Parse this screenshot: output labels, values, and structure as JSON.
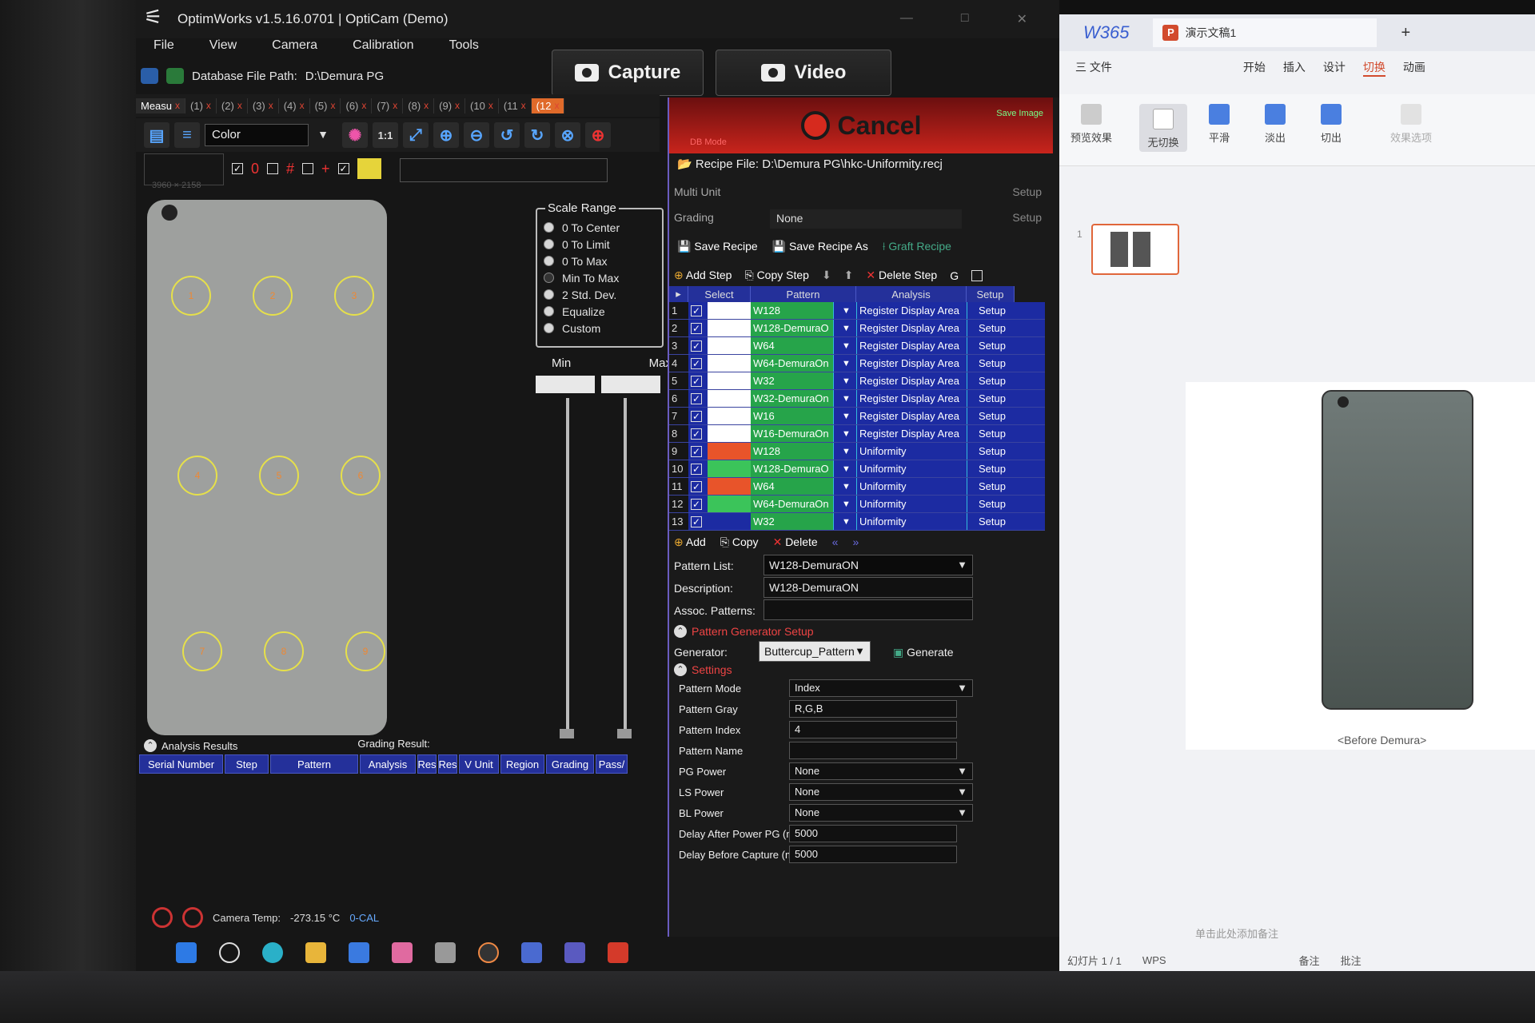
{
  "app": {
    "title": "OptimWorks v1.5.16.0701 | OptiCam (Demo)",
    "menu": [
      "File",
      "View",
      "Camera",
      "Calibration",
      "Tools"
    ],
    "db_label": "Database File Path:",
    "db_path": "D:\\Demura PG",
    "capture": "Capture",
    "video": "Video",
    "tabs": [
      {
        "label": "Measu",
        "close": "x"
      },
      {
        "label": "(1)",
        "close": "x"
      },
      {
        "label": "(2)",
        "close": "x"
      },
      {
        "label": "(3)",
        "close": "x"
      },
      {
        "label": "(4)",
        "close": "x"
      },
      {
        "label": "(5)",
        "close": "x"
      },
      {
        "label": "(6)",
        "close": "x"
      },
      {
        "label": "(7)",
        "close": "x"
      },
      {
        "label": "(8)",
        "close": "x"
      },
      {
        "label": "(9)",
        "close": "x"
      },
      {
        "label": "(10",
        "close": "x"
      },
      {
        "label": "(11",
        "close": "x"
      },
      {
        "label": "(12",
        "close": "x"
      }
    ],
    "color_mode": "Color",
    "zoom_label": "1:1",
    "resolution": "3960 × 2158",
    "spots": [
      "1",
      "2",
      "3",
      "4",
      "5",
      "6",
      "7",
      "8",
      "9"
    ],
    "scale_range": {
      "title": "Scale Range",
      "options": [
        "0 To Center",
        "0 To Limit",
        "0 To Max",
        "Min To Max",
        "2 Std. Dev.",
        "Equalize",
        "Custom"
      ],
      "min_label": "Min",
      "max_label": "Max"
    },
    "analysis": {
      "title": "Analysis Results",
      "grading": "Grading Result:",
      "columns": [
        "Serial Number",
        "Step",
        "Pattern",
        "Analysis",
        "Res",
        "Res",
        "V Unit",
        "Region",
        "Grading",
        "Pass/"
      ]
    },
    "status": {
      "camera_temp_label": "Camera Temp:",
      "camera_temp": "-273.15 °C",
      "cal": "0-CAL"
    }
  },
  "recipe": {
    "cancel": "Cancel",
    "db_mode": "DB Mode",
    "save_image": "Save Image",
    "file_label": "Recipe File:",
    "file_path": "D:\\Demura PG\\hkc-Uniformity.recj",
    "multi_unit": "Multi Unit",
    "grading": "Grading",
    "grading_value": "None",
    "setup": "Setup",
    "save": "Save Recipe",
    "save_as": "Save Recipe As",
    "graft": "Graft Recipe",
    "add_step": "Add Step",
    "copy_step": "Copy Step",
    "delete_step": "Delete Step",
    "g_label": "G",
    "grid_headers": [
      "Select",
      "Pattern",
      "Analysis",
      "Setup"
    ],
    "steps": [
      {
        "n": "1",
        "pattern": "W128",
        "analysis": "Register Display Area",
        "swatch": "#ffffff"
      },
      {
        "n": "2",
        "pattern": "W128-DemuraO",
        "analysis": "Register Display Area",
        "swatch": "#ffffff"
      },
      {
        "n": "3",
        "pattern": "W64",
        "analysis": "Register Display Area",
        "swatch": "#ffffff"
      },
      {
        "n": "4",
        "pattern": "W64-DemuraOn",
        "analysis": "Register Display Area",
        "swatch": "#ffffff"
      },
      {
        "n": "5",
        "pattern": "W32",
        "analysis": "Register Display Area",
        "swatch": "#ffffff"
      },
      {
        "n": "6",
        "pattern": "W32-DemuraOn",
        "analysis": "Register Display Area",
        "swatch": "#ffffff"
      },
      {
        "n": "7",
        "pattern": "W16",
        "analysis": "Register Display Area",
        "swatch": "#ffffff"
      },
      {
        "n": "8",
        "pattern": "W16-DemuraOn",
        "analysis": "Register Display Area",
        "swatch": "#ffffff"
      },
      {
        "n": "9",
        "pattern": "W128",
        "analysis": "Uniformity",
        "swatch": "#e8542a"
      },
      {
        "n": "10",
        "pattern": "W128-DemuraO",
        "analysis": "Uniformity",
        "swatch": "#3bc45a"
      },
      {
        "n": "11",
        "pattern": "W64",
        "analysis": "Uniformity",
        "swatch": "#e8542a"
      },
      {
        "n": "12",
        "pattern": "W64-DemuraOn",
        "analysis": "Uniformity",
        "swatch": "#3bc45a"
      },
      {
        "n": "13",
        "pattern": "W32",
        "analysis": "Uniformity",
        "swatch": "#1c2ba2"
      }
    ],
    "sub_add": "Add",
    "sub_copy": "Copy",
    "sub_delete": "Delete",
    "pattern_list_label": "Pattern List:",
    "pattern_list": "W128-DemuraON",
    "description_label": "Description:",
    "description": "W128-DemuraON",
    "assoc_label": "Assoc. Patterns:",
    "pg_setup": "Pattern Generator Setup",
    "generator_label": "Generator:",
    "generator": "Buttercup_Pattern",
    "generate": "Generate",
    "settings": "Settings",
    "fields": [
      {
        "label": "Pattern Mode",
        "value": "Index",
        "dropdown": true
      },
      {
        "label": "Pattern Gray",
        "value": "R,G,B",
        "dropdown": false
      },
      {
        "label": "Pattern Index",
        "value": "4",
        "dropdown": false
      },
      {
        "label": "Pattern Name",
        "value": "",
        "dropdown": false
      },
      {
        "label": "PG Power",
        "value": "None",
        "dropdown": true
      },
      {
        "label": "LS Power",
        "value": "None",
        "dropdown": true
      },
      {
        "label": "BL Power",
        "value": "None",
        "dropdown": true
      },
      {
        "label": "Delay After Power PG (ms)",
        "value": "5000",
        "dropdown": false
      },
      {
        "label": "Delay Before Capture (ms)",
        "value": "5000",
        "dropdown": false
      }
    ]
  },
  "wps": {
    "logo": "W365",
    "doc_title": "演示文稿1",
    "p_letter": "P",
    "plus": "+",
    "menu": [
      "三 文件",
      "开始",
      "插入",
      "设计",
      "切换",
      "动画"
    ],
    "ribbon": [
      "预览效果",
      "无切换",
      "平滑",
      "淡出",
      "切出",
      "效果选项"
    ],
    "thumb_num": "1",
    "caption": "<Before Demura>",
    "notes": "单击此处添加备注",
    "slide_count": "幻灯片 1 / 1",
    "wps_label": "WPS",
    "notes_btn": "备注",
    "comments_btn": "批注"
  },
  "colors": {
    "grid_blue": "#1c2ba2",
    "pattern_green": "#26a44a",
    "cancel_red": "#c8241c",
    "spot_yellow": "#e6e04a",
    "wps_accent": "#e0663a"
  }
}
